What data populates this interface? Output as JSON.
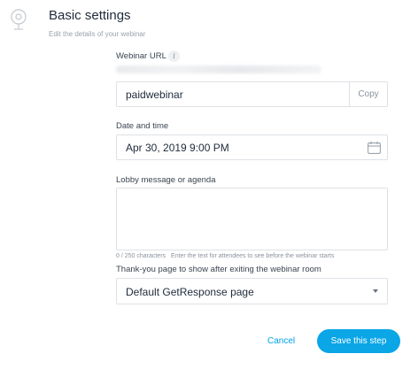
{
  "header": {
    "title": "Basic settings",
    "subtitle": "Edit the details of your webinar",
    "icon": "webcam-icon"
  },
  "form": {
    "webinar_url": {
      "label": "Webinar URL",
      "info_icon": "info-icon",
      "value": "paidwebinar",
      "copy_label": "Copy"
    },
    "date_time": {
      "label": "Date and time",
      "value": "Apr 30, 2019 9:00 PM",
      "icon": "calendar-icon"
    },
    "lobby": {
      "label": "Lobby message or agenda",
      "value": "",
      "counter": "0 / 250 characters",
      "hint": "Enter the text for attendees to see before the webinar starts"
    },
    "thank_you": {
      "label": "Thank-you page to show after exiting the webinar room",
      "selected": "Default GetResponse page"
    }
  },
  "actions": {
    "cancel_label": "Cancel",
    "save_label": "Save this step"
  },
  "colors": {
    "accent": "#0aa6e6",
    "link": "#00a2e8"
  }
}
